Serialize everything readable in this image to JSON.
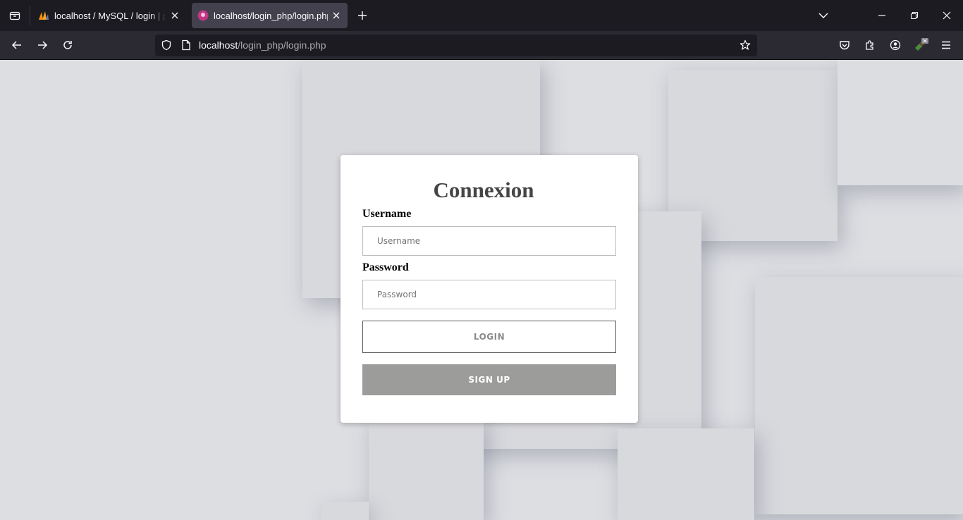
{
  "browser": {
    "tabs": [
      {
        "title": "localhost / MySQL / login | phpMyAdmin",
        "icon": "phpmyadmin-icon",
        "active": false
      },
      {
        "title": "localhost/login_php/login.php",
        "icon": "site-favicon",
        "active": true
      }
    ],
    "url_host": "localhost",
    "url_path": "/login_php/login.php"
  },
  "form": {
    "title": "Connexion",
    "username_label": "Username",
    "username_placeholder": "Username",
    "password_label": "Password",
    "password_placeholder": "Password",
    "login_button": "LOGIN",
    "signup_button": "SIGN UP"
  },
  "colors": {
    "page_background": "#dddee2",
    "signup_button": "#9c9d9a",
    "title_text": "#454545"
  }
}
